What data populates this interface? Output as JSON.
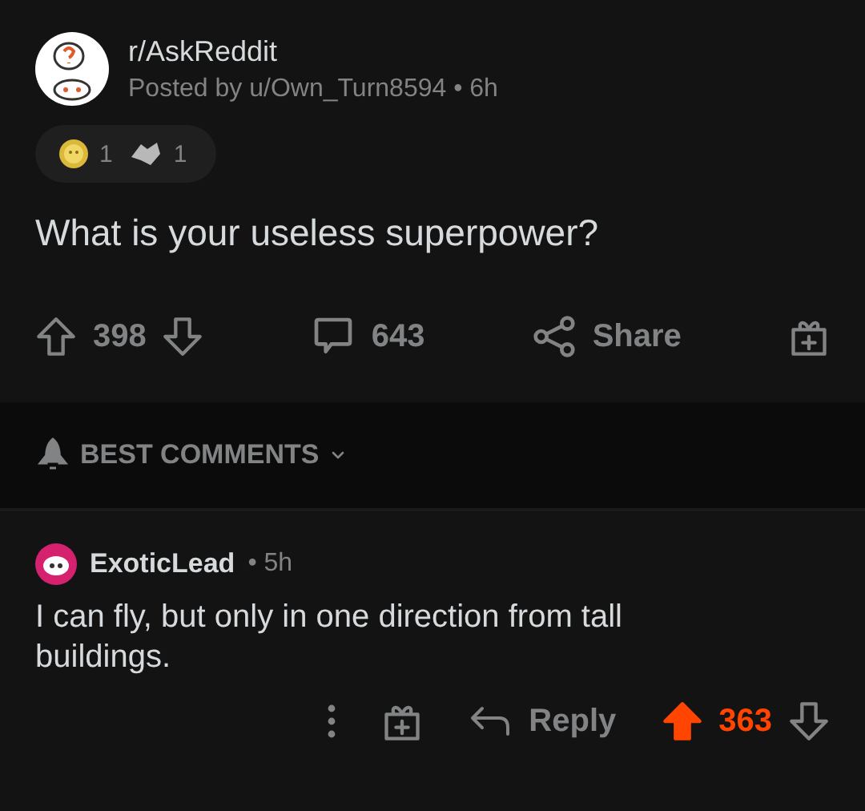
{
  "post": {
    "subreddit": "r/AskReddit",
    "meta": "Posted by u/Own_Turn8594 • 6h",
    "awards": [
      {
        "kind": "gold",
        "count": "1"
      },
      {
        "kind": "hands",
        "count": "1"
      }
    ],
    "title": "What is your useless superpower?",
    "score": "398",
    "upvoted": false,
    "comments": "643",
    "share": "Share"
  },
  "sort": {
    "label": "BEST COMMENTS"
  },
  "comments": [
    {
      "author": "ExoticLead",
      "age": "• 5h",
      "body": "I can fly, but only in one direction from tall buildings.",
      "reply": "Reply",
      "score": "363",
      "upvoted": true
    }
  ]
}
